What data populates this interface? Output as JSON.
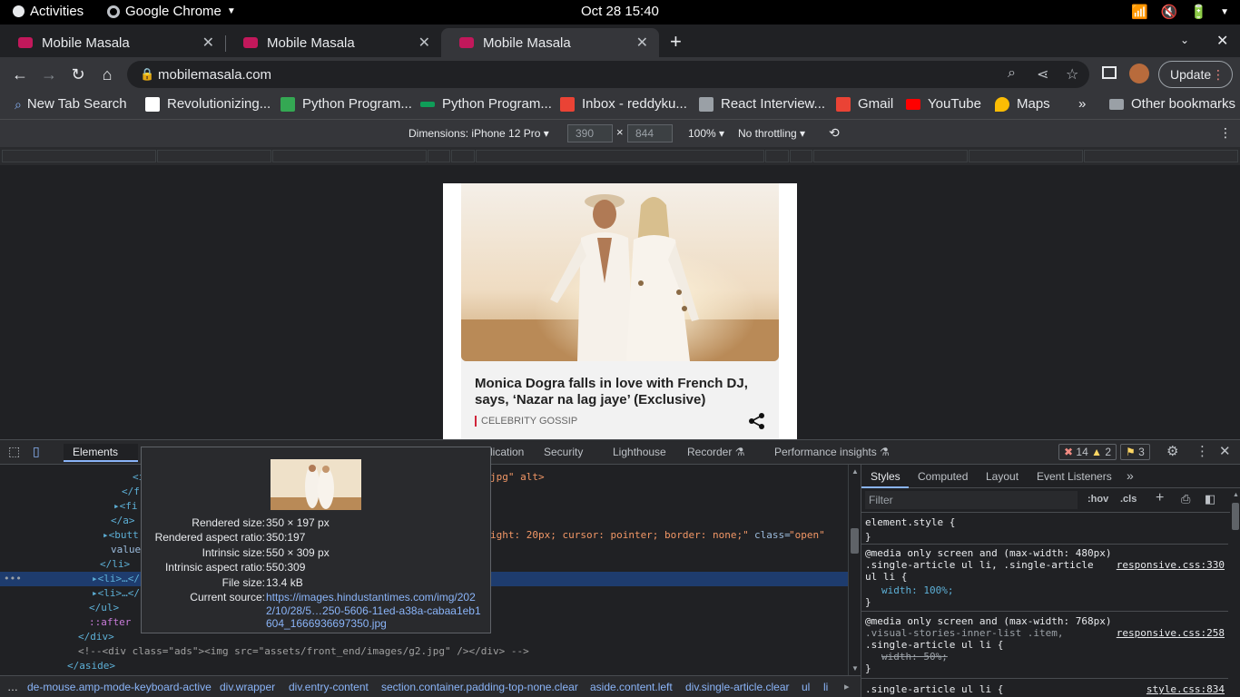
{
  "system": {
    "activities": "Activities",
    "app_name": "Google Chrome",
    "clock": "Oct 28  15:40"
  },
  "tabs": [
    {
      "title": "Mobile Masala"
    },
    {
      "title": "Mobile Masala"
    },
    {
      "title": "Mobile Masala"
    }
  ],
  "toolbar": {
    "url": "mobilemasala.com",
    "update_label": "Update"
  },
  "bookmarks": [
    {
      "label": "New Tab Search",
      "color": "#8ab4f8"
    },
    {
      "label": "Revolutionizing...",
      "color": "#ffffff"
    },
    {
      "label": "Python Program...",
      "color": "#34a853"
    },
    {
      "label": "Python Program...",
      "color": "#0f9d58"
    },
    {
      "label": "Inbox - reddyku...",
      "color": "#ea4335"
    },
    {
      "label": "React Interview...",
      "color": "#9aa0a6"
    },
    {
      "label": "Gmail",
      "color": "#ea4335"
    },
    {
      "label": "YouTube",
      "color": "#ff0000"
    },
    {
      "label": "Maps",
      "color": "#fbbc04"
    }
  ],
  "other_bookmarks": "Other bookmarks",
  "device_toolbar": {
    "dimensions_label": "Dimensions: iPhone 12 Pro",
    "width": "390",
    "height": "844",
    "zoom": "100%",
    "throttling": "No throttling"
  },
  "article": {
    "headline": "Monica Dogra falls in love with French DJ, says, ‘Nazar na lag jaye’ (Exclusive)",
    "category": "CELEBRITY GOSSIP"
  },
  "devtools": {
    "tabs": [
      "Elements",
      "lication",
      "Security",
      "Lighthouse",
      "Recorder",
      "Performance insights"
    ],
    "errors": "14",
    "warnings": "2",
    "issues": "3"
  },
  "elements_lines": [
    {
      "text": "<i",
      "cls": "tagc"
    },
    {
      "text": "</f",
      "cls": "tagc"
    },
    {
      "text": "▸<fi",
      "cls": "tagc"
    },
    {
      "text": "</a>",
      "cls": "tagc"
    },
    {
      "text": "▸<butt",
      "cls": "tagc"
    },
    {
      "text": "value",
      "cls": "attr"
    },
    {
      "text": "</li>",
      "cls": "tagc"
    },
    {
      "text": "▸<li>…</",
      "cls": "tagc"
    },
    {
      "text": "▸<li>…</",
      "cls": "tagc"
    },
    {
      "text": "</ul>",
      "cls": "tagc"
    },
    {
      "text": "::after",
      "cls": "pseudo"
    },
    {
      "text": "</div>",
      "cls": "tagc"
    },
    {
      "text": "<!--<div class=\"ads\"><img src=\"assets/front_end/images/g2.jpg\" /></div> -->",
      "cls": "cmt"
    },
    {
      "text": "</aside>",
      "cls": "tagc"
    }
  ],
  "elements_right": {
    "line1": "jpg\" alt>",
    "line5a": "ight: 20px; cursor: pointer; border: none;\"",
    "line5b": "class=",
    "line5c": "\"open\""
  },
  "tooltip": {
    "rendered_size_k": "Rendered size:",
    "rendered_size_v": "350 × 197 px",
    "rendered_ratio_k": "Rendered aspect ratio:",
    "rendered_ratio_v": "350:197",
    "intrinsic_size_k": "Intrinsic size:",
    "intrinsic_size_v": "550 × 309 px",
    "intrinsic_ratio_k": "Intrinsic aspect ratio:",
    "intrinsic_ratio_v": "550:309",
    "file_size_k": "File size:",
    "file_size_v": "13.4 kB",
    "source_k": "Current source:",
    "source_v": "https://images.hindustantimes.com/img/2022/10/28/5…250-5606-11ed-a38a-cabaa1eb1604_1666936697350.jpg"
  },
  "styles": {
    "tabs": [
      "Styles",
      "Computed",
      "Layout",
      "Event Listeners"
    ],
    "filter_placeholder": "Filter",
    "hov": ":hov",
    "cls": ".cls",
    "rules": [
      {
        "l1": "element.style {",
        "l2": "}",
        "src": ""
      },
      {
        "l1": "@media only screen and (max-width: 480px)",
        "l2": ".single-article ul li, .single-article",
        "l3": "ul li {",
        "l4": "width: 100%;",
        "l5": "}",
        "src": "responsive.css:330"
      },
      {
        "l1": "@media only screen and (max-width: 768px)",
        "l2": ".visual-stories-inner-list .item,",
        "l3": ".single-article ul li {",
        "l4": "width: 50%;",
        "l5": "}",
        "src": "responsive.css:258"
      },
      {
        "l1": ".single-article ul li {",
        "src": "style.css:834"
      }
    ]
  },
  "breadcrumb": [
    "de-mouse.amp-mode-keyboard-active",
    "div.wrapper",
    "div.entry-content",
    "section.container.padding-top-none.clear",
    "aside.content.left",
    "div.single-article.clear",
    "ul",
    "li"
  ]
}
